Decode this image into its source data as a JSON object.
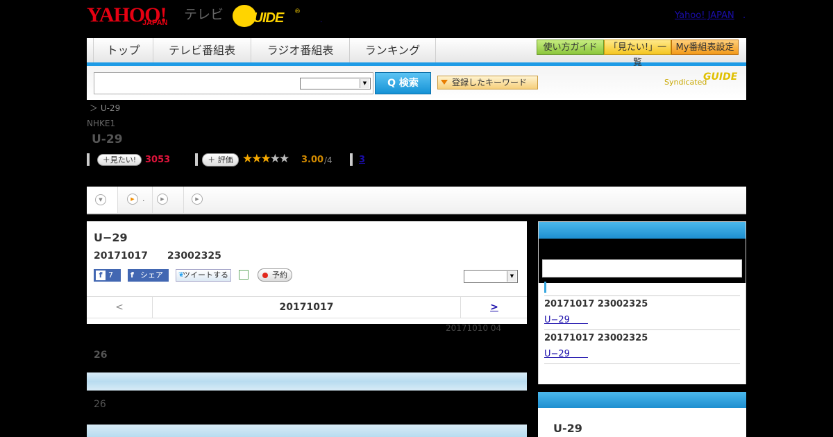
{
  "header": {
    "logo_yahoo": "YAHOO!",
    "logo_japan": "JAPAN",
    "logo_tv": "テレビ",
    "logo_guide": "GUIDE",
    "logo_reg": "®",
    "dot_link": ".",
    "yahoo_japan_link": "Yahoo! JAPAN",
    "yahoo_japan_dot": "."
  },
  "nav": {
    "items": [
      "トップ",
      "テレビ番組表",
      "ラジオ番組表",
      "ランキング"
    ],
    "buttons": [
      {
        "label": "使い方ガイド",
        "color": "#9ed44a"
      },
      {
        "label": "「見たい!」一覧",
        "color": "#f8cf3a"
      },
      {
        "label": "My番組表設定",
        "color": "#f6a830"
      }
    ]
  },
  "search": {
    "placeholder": "",
    "button_label": "Q 検索",
    "keyword_label": "登録したキーワード",
    "syndicated_label": "Syndicated",
    "syndicated_logo": "GUIDE"
  },
  "program": {
    "breadcrumb": "＞ U-29",
    "channel": "NHKE1",
    "title": "U-29",
    "mitai_label": "＋見たい!",
    "mitai_count": "3053",
    "rate_label": "＋ 評価",
    "rating_value": 3,
    "rating_max": 5,
    "rating_text": "3.00",
    "rating_suffix": "/4",
    "review_count": "3"
  },
  "tabs": [
    {
      "icon": "▼",
      "label": ""
    },
    {
      "icon": "▶",
      "label": "."
    },
    {
      "icon": "▶",
      "label": ""
    },
    {
      "icon": "▶",
      "label": ""
    }
  ],
  "main": {
    "title": "U−29",
    "datetime": "20171017　　23002325",
    "fb_like_count": "7",
    "fb_share_label": "シェア",
    "tweet_label": "ツイートする",
    "reserve_label": "予約",
    "date_prev": "<",
    "date_current": "20171017",
    "date_next": ">",
    "updated": "20171010  04",
    "section_num1": "26",
    "section_num2": "26"
  },
  "sidebar": {
    "items": [
      {
        "time": "20171017  23002325",
        "link": "U−29　　"
      },
      {
        "time": "20171017  23002325",
        "link": "U−29　　"
      }
    ],
    "box2_title": "U-29"
  }
}
